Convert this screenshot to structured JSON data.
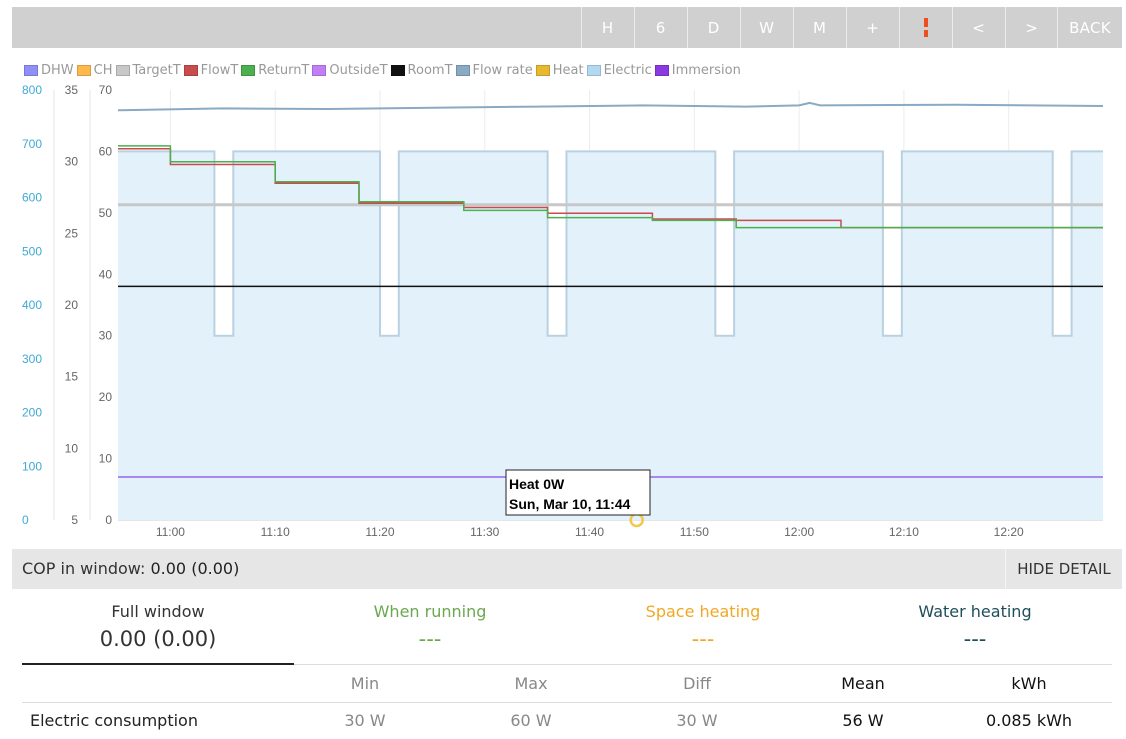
{
  "toolbar": {
    "buttons": [
      "H",
      "6",
      "D",
      "W",
      "M",
      "+",
      "",
      "<",
      ">"
    ],
    "back_label": "BACK"
  },
  "legend": [
    {
      "label": "DHW",
      "color": "#8f8ff7"
    },
    {
      "label": "CH",
      "color": "#ffb84d"
    },
    {
      "label": "TargetT",
      "color": "#c8c8c8"
    },
    {
      "label": "FlowT",
      "color": "#c94c4c"
    },
    {
      "label": "ReturnT",
      "color": "#4caf50"
    },
    {
      "label": "OutsideT",
      "color": "#c27ff5"
    },
    {
      "label": "RoomT",
      "color": "#111111"
    },
    {
      "label": "Flow rate",
      "color": "#8aa9c2"
    },
    {
      "label": "Heat",
      "color": "#e8b830"
    },
    {
      "label": "Electric",
      "color": "#b3d9f2"
    },
    {
      "label": "Immersion",
      "color": "#8a3ae0"
    }
  ],
  "chart_data": {
    "type": "line",
    "x_ticks": [
      "11:00",
      "11:10",
      "11:20",
      "11:30",
      "11:40",
      "11:50",
      "12:00",
      "12:10",
      "12:20"
    ],
    "axes": {
      "power_W": {
        "ticks": [
          "0",
          "100",
          "200",
          "300",
          "400",
          "500",
          "600",
          "700",
          "800"
        ],
        "range": [
          0,
          800
        ],
        "color": "#3fa9d5"
      },
      "temp_C": {
        "ticks": [
          "5",
          "10",
          "15",
          "20",
          "25",
          "30",
          "35"
        ],
        "range": [
          5,
          35
        ]
      },
      "flow": {
        "ticks": [
          "0",
          "10",
          "20",
          "30",
          "40",
          "50",
          "60",
          "70"
        ],
        "range": [
          0,
          70
        ]
      }
    },
    "x_range_min": [
      0,
      94
    ],
    "series": [
      {
        "name": "Electric",
        "unit": "W",
        "points": [
          [
            0,
            60
          ],
          [
            9.2,
            60
          ],
          [
            9.2,
            30
          ],
          [
            11,
            30
          ],
          [
            11,
            60
          ],
          [
            25,
            60
          ],
          [
            25,
            30
          ],
          [
            26.8,
            30
          ],
          [
            26.8,
            60
          ],
          [
            41,
            60
          ],
          [
            41,
            30
          ],
          [
            42.8,
            30
          ],
          [
            42.8,
            60
          ],
          [
            57,
            60
          ],
          [
            57,
            30
          ],
          [
            58.8,
            30
          ],
          [
            58.8,
            60
          ],
          [
            73,
            60
          ],
          [
            73,
            30
          ],
          [
            74.8,
            30
          ],
          [
            74.8,
            60
          ],
          [
            89.2,
            60
          ],
          [
            89.2,
            30
          ],
          [
            91,
            30
          ],
          [
            91,
            60
          ],
          [
            94,
            60
          ]
        ]
      },
      {
        "name": "Flow rate",
        "unit": "",
        "points": [
          [
            0,
            66.7
          ],
          [
            10,
            67
          ],
          [
            20,
            66.9
          ],
          [
            30,
            67.1
          ],
          [
            40,
            67.3
          ],
          [
            50,
            67.5
          ],
          [
            60,
            67.3
          ],
          [
            65,
            67.5
          ],
          [
            66,
            67.9
          ],
          [
            67,
            67.5
          ],
          [
            80,
            67.6
          ],
          [
            94,
            67.4
          ]
        ]
      },
      {
        "name": "TargetT",
        "unit": "C",
        "points": [
          [
            0,
            27
          ],
          [
            94,
            27
          ]
        ]
      },
      {
        "name": "FlowT",
        "unit": "C",
        "points": [
          [
            0,
            30.9
          ],
          [
            5,
            30.9
          ],
          [
            5,
            29.8
          ],
          [
            15,
            29.8
          ],
          [
            15,
            28.5
          ],
          [
            23,
            28.5
          ],
          [
            23,
            27.1
          ],
          [
            33,
            27.1
          ],
          [
            33,
            26.8
          ],
          [
            41,
            26.8
          ],
          [
            41,
            26.4
          ],
          [
            51,
            26.4
          ],
          [
            51,
            26.0
          ],
          [
            59,
            26.0
          ],
          [
            59,
            25.9
          ],
          [
            69,
            25.9
          ],
          [
            69,
            25.4
          ],
          [
            94,
            25.4
          ]
        ]
      },
      {
        "name": "ReturnT",
        "unit": "C",
        "points": [
          [
            0,
            31.1
          ],
          [
            5,
            31.1
          ],
          [
            5,
            30.0
          ],
          [
            15,
            30.0
          ],
          [
            15,
            28.6
          ],
          [
            23,
            28.6
          ],
          [
            23,
            27.2
          ],
          [
            33,
            27.2
          ],
          [
            33,
            26.6
          ],
          [
            41,
            26.6
          ],
          [
            41,
            26.1
          ],
          [
            51,
            26.1
          ],
          [
            51,
            25.9
          ],
          [
            59,
            25.9
          ],
          [
            59,
            25.4
          ],
          [
            69,
            25.4
          ],
          [
            69,
            25.4
          ],
          [
            94,
            25.4
          ]
        ]
      },
      {
        "name": "RoomT",
        "unit": "C",
        "points": [
          [
            0,
            21.3
          ],
          [
            94,
            21.3
          ]
        ]
      },
      {
        "name": "OutsideT",
        "unit": "C",
        "points": [
          [
            0,
            8.0
          ],
          [
            94,
            8.0
          ]
        ]
      }
    ],
    "tooltip": {
      "line1": "Heat 0W",
      "line2": "Sun, Mar 10, 11:44",
      "x_min": 49.5
    }
  },
  "cop": {
    "label": "COP in window:",
    "value": "0.00 (0.00)",
    "hide_label": "HIDE DETAIL"
  },
  "tabs": [
    {
      "title": "Full window",
      "value": "0.00 (0.00)",
      "color": "#333333"
    },
    {
      "title": "When running",
      "value": "---",
      "color": "#6aa84f"
    },
    {
      "title": "Space heating",
      "value": "---",
      "color": "#f0a824"
    },
    {
      "title": "Water heating",
      "value": "---",
      "color": "#1d4e5a"
    }
  ],
  "stats": {
    "headers": [
      "Min",
      "Max",
      "Diff",
      "Mean",
      "kWh"
    ],
    "rows": [
      {
        "label": "Electric consumption",
        "min": "30 W",
        "max": "60 W",
        "diff": "30 W",
        "mean": "56 W",
        "kwh": "0.085 kWh"
      }
    ]
  }
}
